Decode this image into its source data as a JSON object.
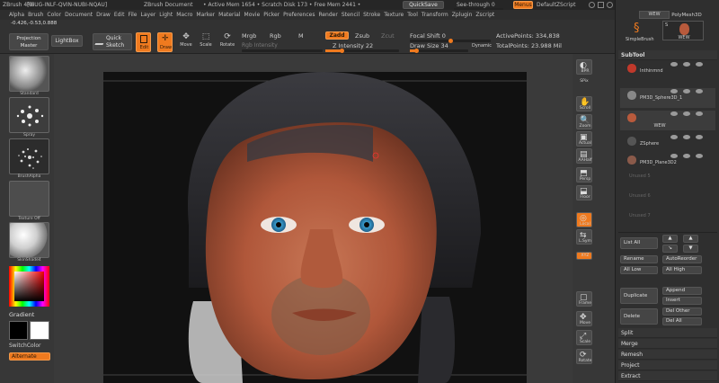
{
  "titlebar": {
    "app": "ZBrush 4R6",
    "build": "[BIUG-INLF-QVIN-NUBI-NQAU]",
    "doc": "ZBrush Document",
    "status": "• Active Mem 1654 • Scratch Disk 173 • Free Mem 2441 •",
    "quicksave": "QuickSave",
    "seethrough": "See-through",
    "seethrough_val": "0",
    "menus": "Menus",
    "script": "DefaultZScript"
  },
  "menubar": [
    "Alpha",
    "Brush",
    "Color",
    "Document",
    "Draw",
    "Edit",
    "File",
    "Layer",
    "Light",
    "Macro",
    "Marker",
    "Material",
    "Movie",
    "Picker",
    "Preferences",
    "Render",
    "Stencil",
    "Stroke",
    "Texture",
    "Tool",
    "Transform",
    "Zplugin",
    "Zscript"
  ],
  "shelf": {
    "coords": "-0.426,-0.53,0.888",
    "projection_master": "Projection Master",
    "lightbox": "LightBox",
    "quick_sketch": "Quick Sketch",
    "edit": "Edit",
    "draw": "Draw",
    "move": "Move",
    "scale": "Scale",
    "rotate": "Rotate",
    "mrgb": "Mrgb",
    "rgb": "Rgb",
    "m": "M",
    "rgb_intensity": "Rgb Intensity",
    "zadd": "Zadd",
    "zsub": "Zsub",
    "zcut": "Zcut",
    "z_intensity_label": "Z Intensity",
    "z_intensity": "22",
    "z_intensity_frac": 0.22,
    "focal_shift_label": "Focal Shift",
    "focal_shift": "0",
    "focal_frac": 0.5,
    "draw_size_label": "Draw Size",
    "draw_size": "34",
    "draw_size_frac": 0.1,
    "dynamic": "Dynamic",
    "active_points": "ActivePoints: 334,838",
    "total_points": "TotalPoints: 23.988 Mil"
  },
  "left": {
    "brush": "Standard",
    "stroke": "Spray",
    "alpha": "BrushAlpha",
    "texture": "Texture Off",
    "material": "SkinShade4",
    "gradient": "Gradient",
    "switch_color": "SwitchColor",
    "alternate": "Alternate"
  },
  "right_shelf": [
    "BPR",
    "SPix",
    "Scroll",
    "Zoom",
    "Actual",
    "AAHalf",
    "Persp",
    "Floor",
    "Local",
    "L.Sym",
    "XYZ",
    "Frame",
    "Move",
    "Scale",
    "Rotate"
  ],
  "rpanel": {
    "top_label1": "WEW",
    "polymesh": "PolyMesh3D",
    "simplebrush": "SimpleBrush",
    "wew": "WEW",
    "s_label": "S",
    "subtool_title": "SubTool",
    "subtools": [
      {
        "name": "Inthinmnd"
      },
      {
        "name": "PM3D_Sphere3D_1"
      },
      {
        "name": "WEW"
      },
      {
        "name": "ZSphere"
      },
      {
        "name": "PM3D_Plane3D2"
      }
    ],
    "unused": [
      "Unused 5",
      "Unused 6",
      "Unused 7"
    ],
    "list_all": "List All",
    "rename": "Rename",
    "autoreorder": "AutoReorder",
    "all_low": "All Low",
    "all_high": "All High",
    "duplicate": "Duplicate",
    "append": "Append",
    "insert": "Insert",
    "delete": "Delete",
    "del_other": "Del Other",
    "del_all": "Del All",
    "sections": [
      "Split",
      "Merge",
      "Remesh",
      "Project",
      "Extract"
    ]
  },
  "colors": {
    "accent": "#ef7a1f",
    "bg": "#3b3b3b",
    "panel": "#2f2f2f"
  }
}
